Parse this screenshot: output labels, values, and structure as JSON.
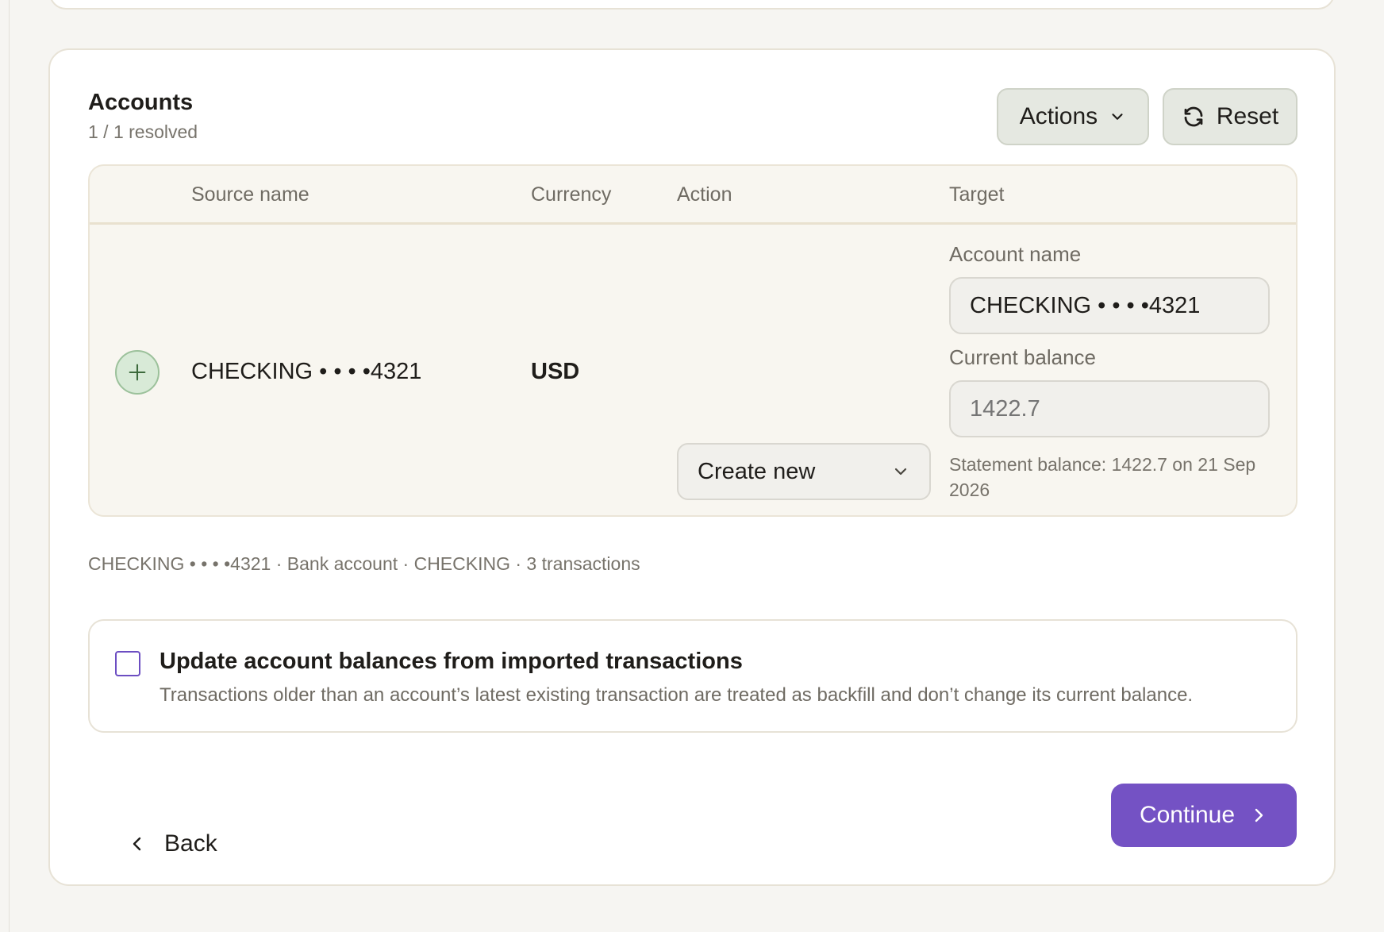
{
  "accounts": {
    "title": "Accounts",
    "resolved_status": "1 / 1 resolved",
    "actions_label": "Actions",
    "reset_label": "Reset"
  },
  "table": {
    "headers": {
      "source_name": "Source name",
      "currency": "Currency",
      "action": "Action",
      "target": "Target"
    },
    "row": {
      "source_name": "CHECKING • • • •4321",
      "currency": "USD",
      "action_selected": "Create new",
      "target": {
        "account_name_label": "Account name",
        "account_name_value": "CHECKING • • • •4321",
        "current_balance_label": "Current balance",
        "current_balance_placeholder": "1422.7",
        "statement_note": "Statement balance: 1422.7 on 21 Sep 2026"
      }
    }
  },
  "summary_line": "CHECKING • • • •4321 · Bank account · CHECKING · 3 transactions",
  "update_balances": {
    "checked": false,
    "title": "Update account balances from imported transactions",
    "description": "Transactions older than an account’s latest existing transaction are treated as backfill and don’t change its current balance."
  },
  "footer": {
    "back_label": "Back",
    "continue_label": "Continue"
  },
  "colors": {
    "primary": "#7452c4",
    "checkbox_border": "#6c4ec2",
    "plus_badge_bg": "#d8ead7"
  },
  "icons": {
    "actions_chevron": "chevron-down-icon",
    "reset": "refresh-icon",
    "plus": "plus-icon",
    "select_chevron": "chevron-down-icon",
    "back": "chevron-left-icon",
    "continue": "chevron-right-icon"
  }
}
